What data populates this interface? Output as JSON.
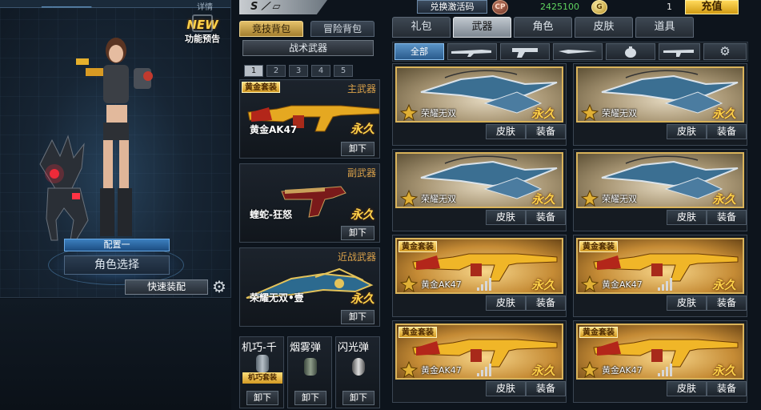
{
  "left": {
    "title_partial": "详情",
    "new_badge": "NEW",
    "preview_label": "功能预告",
    "config_label": "配置一",
    "role_select": "角色选择",
    "quick_equip": "快速装配"
  },
  "middle": {
    "bag_tabs": [
      "竞技背包",
      "冒险背包"
    ],
    "tactical": "战术武器",
    "pages": [
      "1",
      "2",
      "3",
      "4",
      "5"
    ],
    "active_page": "1",
    "primary": {
      "category": "主武器",
      "tag": "黄金套装",
      "name": "黄金AK47",
      "duration": "永久",
      "unload": "卸下"
    },
    "secondary": {
      "category": "副武器",
      "name": "蝰蛇-狂怒",
      "duration": "永久",
      "unload": "卸下"
    },
    "melee": {
      "category": "近战武器",
      "name": "荣耀无双•壹",
      "duration": "永久",
      "unload": "卸下"
    },
    "throwables": [
      {
        "label": "机巧-千",
        "tag": "机巧套装",
        "unload": "卸下"
      },
      {
        "label": "烟雾弹",
        "unload": "卸下"
      },
      {
        "label": "闪光弹",
        "unload": "卸下"
      }
    ]
  },
  "header": {
    "redeem": "兑换激活码",
    "cp_icon": "CP",
    "cp_value": "2425100",
    "gc_icon": "G",
    "gc_value": "1",
    "recharge": "充值"
  },
  "shop": {
    "tabs": [
      "礼包",
      "武器",
      "角色",
      "皮肤",
      "道具"
    ],
    "active_tab": "武器",
    "sub_all": "全部",
    "sub_icons": [
      "rifle-icon",
      "pistol-icon",
      "knife-icon",
      "grenade-icon",
      "smg-icon",
      "gear-icon"
    ],
    "skin_btn": "皮肤",
    "equip_btn": "装备",
    "items": [
      {
        "name": "荣耀无双",
        "duration": "永久",
        "kind": "spec"
      },
      {
        "name": "荣耀无双",
        "duration": "永久",
        "kind": "spec"
      },
      {
        "name": "荣耀无双",
        "duration": "永久",
        "kind": "spec"
      },
      {
        "name": "荣耀无双",
        "duration": "永久",
        "kind": "spec"
      },
      {
        "name": "黄金AK47",
        "duration": "永久",
        "kind": "gold",
        "tag": "黄金套装"
      },
      {
        "name": "黄金AK47",
        "duration": "永久",
        "kind": "gold",
        "tag": "黄金套装"
      },
      {
        "name": "黄金AK47",
        "duration": "永久",
        "kind": "gold",
        "tag": "黄金套装"
      },
      {
        "name": "黄金AK47",
        "duration": "永久",
        "kind": "gold",
        "tag": "黄金套装"
      }
    ]
  },
  "colors": {
    "gold": "#ffd24a",
    "accent_blue": "#3b7fbe",
    "cp_green": "#5fd35f"
  }
}
